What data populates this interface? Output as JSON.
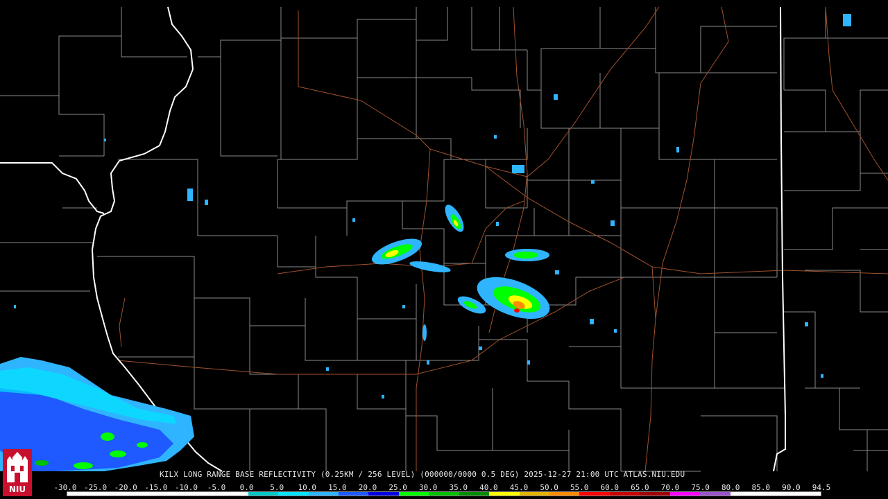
{
  "caption": "KILX LONG RANGE BASE REFLECTIVITY (0.25KM / 256 LEVEL) (000000/0000 0.5 DEG) 2025-12-27 21:00 UTC  ATLAS.NIU.EDU",
  "logo": {
    "text": "NIU",
    "icon": "niu-castle-logo"
  },
  "scale": {
    "labels": [
      "-30.0",
      "-25.0",
      "-20.0",
      "-15.0",
      "-10.0",
      "-5.0",
      "0.0",
      "5.0",
      "10.0",
      "15.0",
      "20.0",
      "25.0",
      "30.0",
      "35.0",
      "40.0",
      "45.0",
      "50.0",
      "55.0",
      "60.0",
      "65.0",
      "70.0",
      "75.0",
      "80.0",
      "85.0",
      "90.0",
      "94.5"
    ],
    "colors": [
      "#ffffff",
      "#ffffff",
      "#ffffff",
      "#ffffff",
      "#ffffff",
      "#ffffff",
      "#00c8c8",
      "#00e5ff",
      "#2fb4ff",
      "#1e5aff",
      "#0000e0",
      "#00ff00",
      "#00c000",
      "#008c00",
      "#ffff00",
      "#e6b400",
      "#ff8c00",
      "#ff0000",
      "#c80000",
      "#a00000",
      "#ff00ff",
      "#9a55cc",
      "#ffffff",
      "#ffffff",
      "#ffffff"
    ]
  },
  "colors": {
    "background": "#000000",
    "county_lines": "#8a8a8a",
    "state_lines": "#ffffff",
    "highways": "#a0522d"
  }
}
